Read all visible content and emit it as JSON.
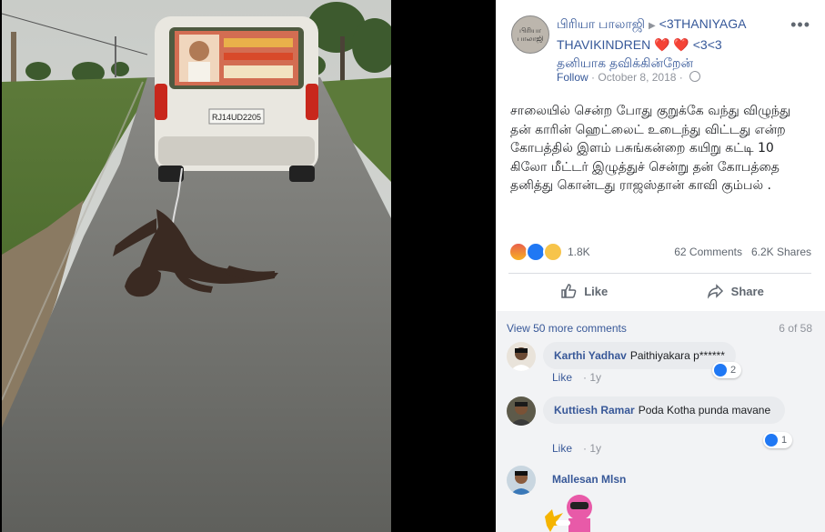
{
  "post": {
    "page_name": "பிரியா பாலாஜி",
    "arrow": "▶",
    "group_name_part1": "<3THANIYAGA THAVIKINDREN",
    "hearts": "❤️ ❤️",
    "group_name_part2": "<3<3",
    "group_name_tamil": "தனியாக தவிக்கின்றேன்",
    "avatar_text": "பிரியா பாலாஜி",
    "follow_label": "Follow",
    "meta_sep": "·",
    "date": "October 8, 2018",
    "meta_sep2": "·",
    "body_text": "சாலையில் சென்ற போது குறுக்கே வந்து விழுந்து தன் காரின் ஹெட்லைட் உடைந்து விட்டது என்ற கோபத்தில் இளம் பசுங்கன்றை கயிறு கட்டி 10 கிலோ மீட்டர் இழுத்துச் சென்று தன் கோபத்தை தனித்து கொன்டது ராஜஸ்தான் காவி கும்பல் .",
    "more_icon": "•••",
    "reaction_count": "1.8K",
    "comments_count": "62 Comments",
    "shares_count": "6.2K Shares",
    "like_label": "Like",
    "share_label": "Share"
  },
  "photo": {
    "plate_text": "RJ14UD2205"
  },
  "comments": {
    "view_more": "View 50 more comments",
    "page_count": "6 of 58",
    "items": [
      {
        "name": "Karthi Yadhav",
        "text": "Paithiyakara p******",
        "like": "Like",
        "sep": "·",
        "time": "1y",
        "likes": "2"
      },
      {
        "name": "Kuttiesh Ramar",
        "text": "Poda Kotha punda mavane",
        "like": "Like",
        "sep": "·",
        "time": "1y",
        "likes": "1"
      },
      {
        "name": "Mallesan Mlsn",
        "text": ""
      }
    ]
  },
  "colors": {
    "link_blue": "#385898",
    "like_blue": "#2078f4",
    "heart_red": "#e0245e"
  }
}
